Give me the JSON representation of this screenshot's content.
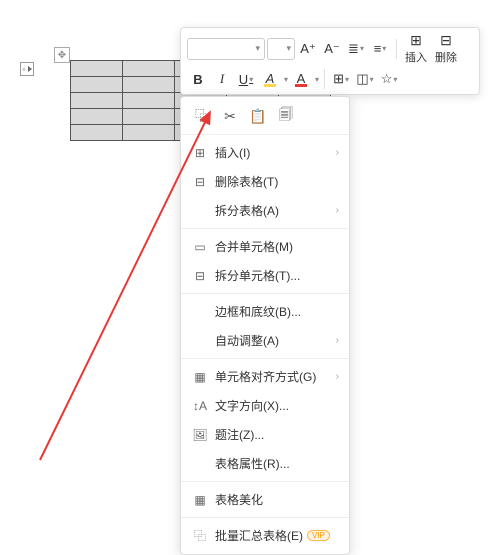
{
  "toolbar": {
    "font_inc": "A⁺",
    "font_dec": "A⁻",
    "bold": "B",
    "italic": "I",
    "underline": "U",
    "highlight": "A",
    "fontcolor": "A",
    "insert_label": "插入",
    "delete_label": "删除"
  },
  "clipboard": {
    "copy": "⿻",
    "cut": "✂",
    "paste": "📋",
    "paste_special": "🗐"
  },
  "menu": {
    "insert": "插入(I)",
    "delete_table": "删除表格(T)",
    "split_table": "拆分表格(A)",
    "merge_cells": "合并单元格(M)",
    "split_cells": "拆分单元格(T)...",
    "borders_shading": "边框和底纹(B)...",
    "auto_fit": "自动调整(A)",
    "cell_alignment": "单元格对齐方式(G)",
    "text_direction": "文字方向(X)...",
    "caption": "题注(Z)...",
    "table_properties": "表格属性(R)...",
    "table_beautify": "表格美化",
    "batch_summary": "批量汇总表格(E)"
  },
  "badges": {
    "vip": "VIP"
  },
  "table": {
    "rows": 5,
    "cols": 5
  }
}
